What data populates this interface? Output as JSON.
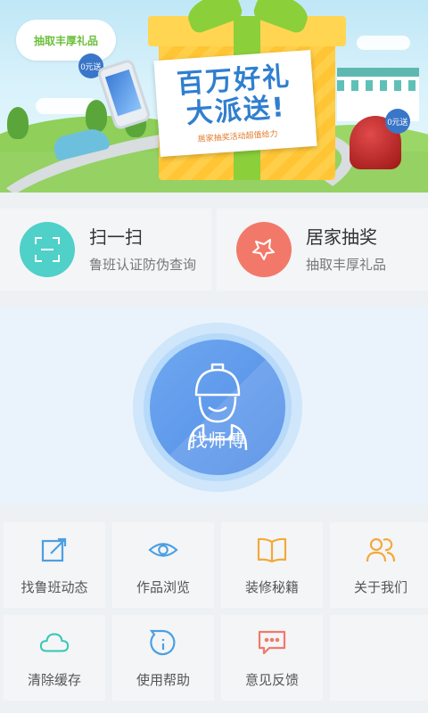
{
  "banner": {
    "bubble_text": "抽取丰厚礼品",
    "tag_left": "0元送",
    "tag_right": "0元送",
    "headline_1": "百万好礼",
    "headline_2": "大派送!",
    "caption": "居家抽奖活动超值给力",
    "colors": {
      "sky": "#bfe7f6",
      "grass": "#95d163",
      "gift": "#ffcf4a",
      "ribbon": "#8bcf3a",
      "headline": "#2f7fcf"
    }
  },
  "quick": [
    {
      "title": "扫一扫",
      "subtitle": "鲁班认证防伪查询",
      "icon": "scan-icon",
      "color": "#4fd0c9"
    },
    {
      "title": "居家抽奖",
      "subtitle": "抽取丰厚礼品",
      "icon": "star-draw-icon",
      "color": "#f2796a"
    }
  ],
  "hero": {
    "button_label": "找师傅",
    "icon": "worker-icon",
    "color": "#5a95ea"
  },
  "grid": [
    {
      "label": "找鲁班动态",
      "icon": "edit-icon"
    },
    {
      "label": "作品浏览",
      "icon": "eye-icon"
    },
    {
      "label": "装修秘籍",
      "icon": "book-icon"
    },
    {
      "label": "关于我们",
      "icon": "people-icon"
    },
    {
      "label": "清除缓存",
      "icon": "cloud-icon"
    },
    {
      "label": "使用帮助",
      "icon": "help-icon"
    },
    {
      "label": "意见反馈",
      "icon": "feedback-icon"
    },
    {
      "label": "",
      "icon": ""
    }
  ]
}
